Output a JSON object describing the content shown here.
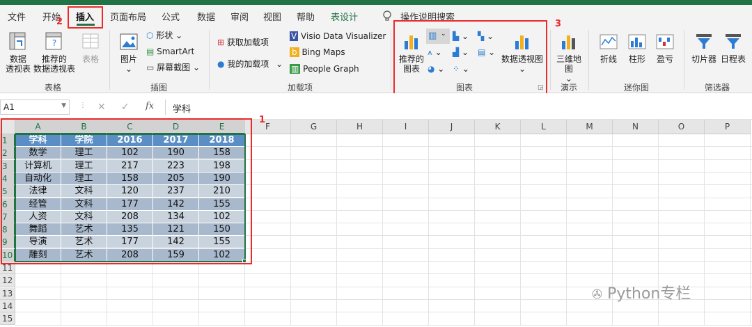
{
  "tabs": [
    {
      "label": "文件"
    },
    {
      "label": "开始"
    },
    {
      "label": "插入"
    },
    {
      "label": "页面布局"
    },
    {
      "label": "公式"
    },
    {
      "label": "数据"
    },
    {
      "label": "审阅"
    },
    {
      "label": "视图"
    },
    {
      "label": "帮助"
    },
    {
      "label": "表设计"
    }
  ],
  "tell_me": "操作说明搜索",
  "ribbon": {
    "tables": {
      "pivot": [
        "数据",
        "透视表"
      ],
      "rec_pivot": [
        "推荐的",
        "数据透视表"
      ],
      "table": "表格",
      "group": "表格"
    },
    "illustrations": {
      "pictures": "图片",
      "shapes": "形状",
      "smartart": "SmartArt",
      "screenshot": "屏幕截图",
      "group": "插图"
    },
    "addins": {
      "get": "获取加载项",
      "mine": "我的加载项",
      "visio": "Visio Data Visualizer",
      "bing": "Bing Maps",
      "people": "People Graph",
      "group": "加载项"
    },
    "charts": {
      "recommended": [
        "推荐的",
        "图表"
      ],
      "pivot_chart": "数据透视图",
      "group": "图表"
    },
    "tours": {
      "map3d": [
        "三维地",
        "图"
      ],
      "group": "演示"
    },
    "sparklines": {
      "line": "折线",
      "column": "柱形",
      "winloss": "盈亏",
      "group": "迷你图"
    },
    "filters": {
      "slicer": "切片器",
      "timeline": "日程表",
      "group": "筛选器"
    }
  },
  "annotations": {
    "n1": "1",
    "n2": "2",
    "n3": "3"
  },
  "formula_bar": {
    "namebox": "A1",
    "fx": "fx",
    "content": "学科"
  },
  "columns": [
    "A",
    "B",
    "C",
    "D",
    "E",
    "F",
    "G",
    "H",
    "I",
    "J",
    "K",
    "L",
    "M",
    "N",
    "O",
    "P"
  ],
  "rows": [
    "1",
    "2",
    "3",
    "4",
    "5",
    "6",
    "7",
    "8",
    "9",
    "10",
    "11",
    "12",
    "13",
    "14",
    "15"
  ],
  "table": {
    "headers": [
      "学科",
      "学院",
      "2016",
      "2017",
      "2018"
    ],
    "rows": [
      [
        "数学",
        "理工",
        "102",
        "190",
        "158"
      ],
      [
        "计算机",
        "理工",
        "217",
        "223",
        "198"
      ],
      [
        "自动化",
        "理工",
        "158",
        "205",
        "190"
      ],
      [
        "法律",
        "文科",
        "120",
        "237",
        "210"
      ],
      [
        "经管",
        "文科",
        "177",
        "142",
        "155"
      ],
      [
        "人资",
        "文科",
        "208",
        "134",
        "102"
      ],
      [
        "舞蹈",
        "艺术",
        "135",
        "121",
        "150"
      ],
      [
        "导演",
        "艺术",
        "177",
        "142",
        "155"
      ],
      [
        "雕刻",
        "艺术",
        "208",
        "159",
        "102"
      ]
    ]
  },
  "watermark": "Python专栏",
  "colors": {
    "excel_green": "#217346",
    "header_blue": "#5b8ec5",
    "band_dark": "#a9b9cd",
    "band_light": "#c9d3de",
    "annotation_red": "#ec2a2a"
  }
}
